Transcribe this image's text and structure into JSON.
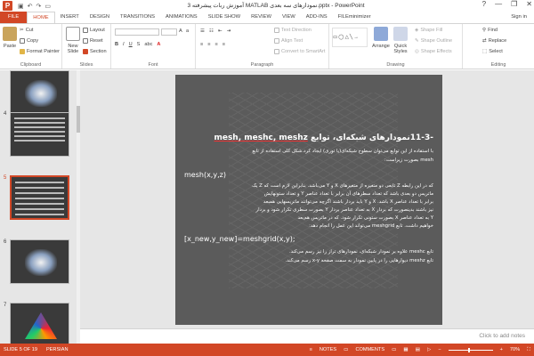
{
  "window": {
    "title": "آموزش ربات پیشرفته 3 MATLAB نمودارهای سه بعدی.pptx - PowerPoint",
    "sign_in": "Sign in",
    "controls": [
      "?",
      "—",
      "❐",
      "✕"
    ]
  },
  "tabs": [
    "FILE",
    "HOME",
    "INSERT",
    "DESIGN",
    "TRANSITIONS",
    "ANIMATIONS",
    "SLIDE SHOW",
    "REVIEW",
    "VIEW",
    "ADD-INS",
    "FILEminimizer"
  ],
  "active_tab": "HOME",
  "ribbon": {
    "clipboard": {
      "paste": "Paste",
      "cut": "Cut",
      "copy": "Copy",
      "format_painter": "Format Painter",
      "label": "Clipboard"
    },
    "slides": {
      "new_slide": "New Slide",
      "layout": "Layout",
      "reset": "Reset",
      "section": "Section",
      "label": "Slides"
    },
    "font": {
      "label": "Font"
    },
    "paragraph": {
      "text_direction": "Text Direction",
      "align_text": "Align Text",
      "convert_smartart": "Convert to SmartArt",
      "label": "Paragraph"
    },
    "drawing": {
      "arrange": "Arrange",
      "quick_styles": "Quick Styles",
      "shape_fill": "Shape Fill",
      "shape_outline": "Shape Outline",
      "shape_effects": "Shape Effects",
      "label": "Drawing"
    },
    "editing": {
      "find": "Find",
      "replace": "Replace",
      "select": "Select",
      "label": "Editing"
    }
  },
  "thumbnails": [
    {
      "num": "4"
    },
    {
      "num": "5"
    },
    {
      "num": "6"
    },
    {
      "num": "7"
    }
  ],
  "slide": {
    "title_rtl": "-11-3نمودارهای شبکه‌ای، توابع",
    "title_ltr": "mesh, meshc, meshz",
    "line1": "با استفاده از این توابع می‌توان سطوح شبکه‌ای(یا توری) ایجاد کرد.شکل کلی استفاده از تابع",
    "line2": "mesh بصورت زیراست:",
    "code1": "mesh(x,y,z)",
    "p1": "که در این رابطه Z تابعی دو متغیره از متغیرهای X و Y می‌باشد. بنابراین لازم است که Z یک",
    "p2": "ماتریس دو بعدی باشد که تعداد سطرهای آن برابر با تعداد عناصر Y و تعداد ستونهایش",
    "p3": "برابر با تعداد عناصر X باشد. X و Y باید بردار باشند اگرچه می‌توانند ماتریسهایی همبعد",
    "p4": "نیز باشند بدینصورت که بردار X به تعداد عناصر بردار Y بصورت سطری تکرار شود و بردار",
    "p5": "Y به تعداد عناصر X بصورت ستونی تکرار شود. که در ماتریس هم‌بعد",
    "p6": "خواهیم داشت. تابع meshgrid می‌تواند این عمل را انجام دهد:",
    "code2": "[x_new,y_new]=meshgrid(x,y);",
    "p7": "تابع meshc علاوه بر نمودار شبکه‌ای، نمودارهای تراز را نیز رسم می‌کند.",
    "p8": "تابع meshz دیوارهایی را در پایین نمودار به سمت صفحه x-y رسم می‌کند."
  },
  "notes_placeholder": "Click to add notes",
  "status": {
    "slide_of": "SLIDE 5 OF 19",
    "language": "PERSIAN",
    "notes": "NOTES",
    "comments": "COMMENTS",
    "zoom": "70%"
  },
  "colors": {
    "accent": "#d24726",
    "slide_bg": "#5b5b5b",
    "pane_bg": "#e6e6e6"
  }
}
